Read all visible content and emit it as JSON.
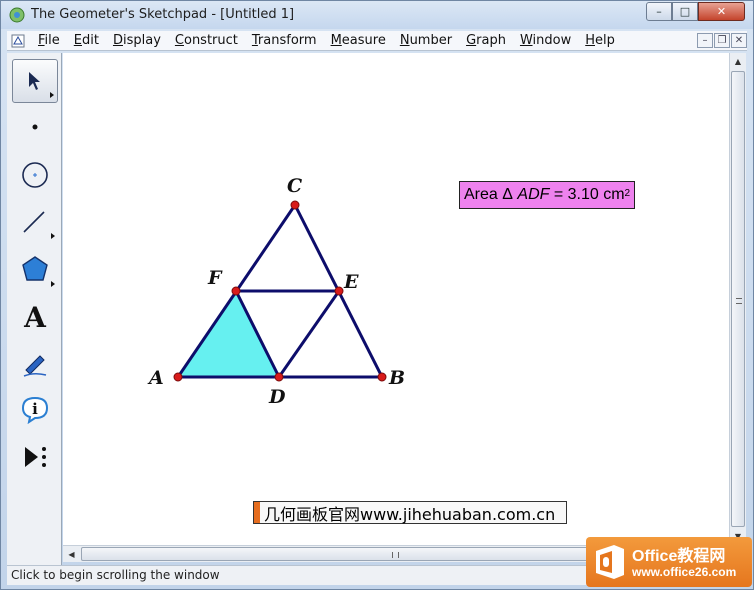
{
  "window": {
    "title": "The Geometer's Sketchpad - [Untitled 1]",
    "controls": {
      "minimize": "–",
      "maximize": "□",
      "close": "✕"
    }
  },
  "menubar": {
    "items": [
      {
        "label": "File",
        "accel": "F",
        "rest": "ile"
      },
      {
        "label": "Edit",
        "accel": "E",
        "rest": "dit"
      },
      {
        "label": "Display",
        "accel": "D",
        "rest": "isplay"
      },
      {
        "label": "Construct",
        "accel": "C",
        "rest": "onstruct"
      },
      {
        "label": "Transform",
        "accel": "T",
        "rest": "ransform"
      },
      {
        "label": "Measure",
        "accel": "M",
        "rest": "easure"
      },
      {
        "label": "Number",
        "accel": "N",
        "rest": "umber"
      },
      {
        "label": "Graph",
        "accel": "G",
        "rest": "raph"
      },
      {
        "label": "Window",
        "accel": "W",
        "rest": "indow"
      },
      {
        "label": "Help",
        "accel": "H",
        "rest": "elp"
      }
    ],
    "mdi": {
      "minimize": "–",
      "restore": "❐",
      "close": "✕"
    }
  },
  "toolbox": {
    "tools": [
      {
        "name": "arrow-tool",
        "icon": "arrow-icon",
        "active": true
      },
      {
        "name": "point-tool",
        "icon": "point-icon"
      },
      {
        "name": "compass-tool",
        "icon": "circle-icon"
      },
      {
        "name": "straightedge-tool",
        "icon": "segment-icon"
      },
      {
        "name": "polygon-tool",
        "icon": "polygon-icon"
      },
      {
        "name": "text-tool",
        "icon": "text-a-icon",
        "label": "A"
      },
      {
        "name": "marker-tool",
        "icon": "pen-icon"
      },
      {
        "name": "information-tool",
        "icon": "info-icon",
        "label": "i"
      },
      {
        "name": "custom-tool",
        "icon": "play-more-icon"
      }
    ]
  },
  "sketch": {
    "points": {
      "A": "A",
      "B": "B",
      "C": "C",
      "D": "D",
      "E": "E",
      "F": "F"
    },
    "colors": {
      "segment": "#0d0d6b",
      "point": "#d81b1b",
      "fill": "#66f0f0"
    },
    "measurement": {
      "prefix": "Area",
      "delta": "Δ",
      "triangle": "ADF",
      "equals": "= 3.10 cm",
      "exponent": "2",
      "background": "#ee82ee"
    },
    "watermark": "几何画板官网www.jihehuaban.com.cn"
  },
  "scroll": {
    "up": "▲",
    "down": "▼",
    "left": "◀",
    "right": "▶"
  },
  "status": {
    "text": "Click to begin scrolling the window"
  },
  "badge": {
    "title": "Office教程网",
    "url": "www.office26.com",
    "color": "#e8802a"
  }
}
